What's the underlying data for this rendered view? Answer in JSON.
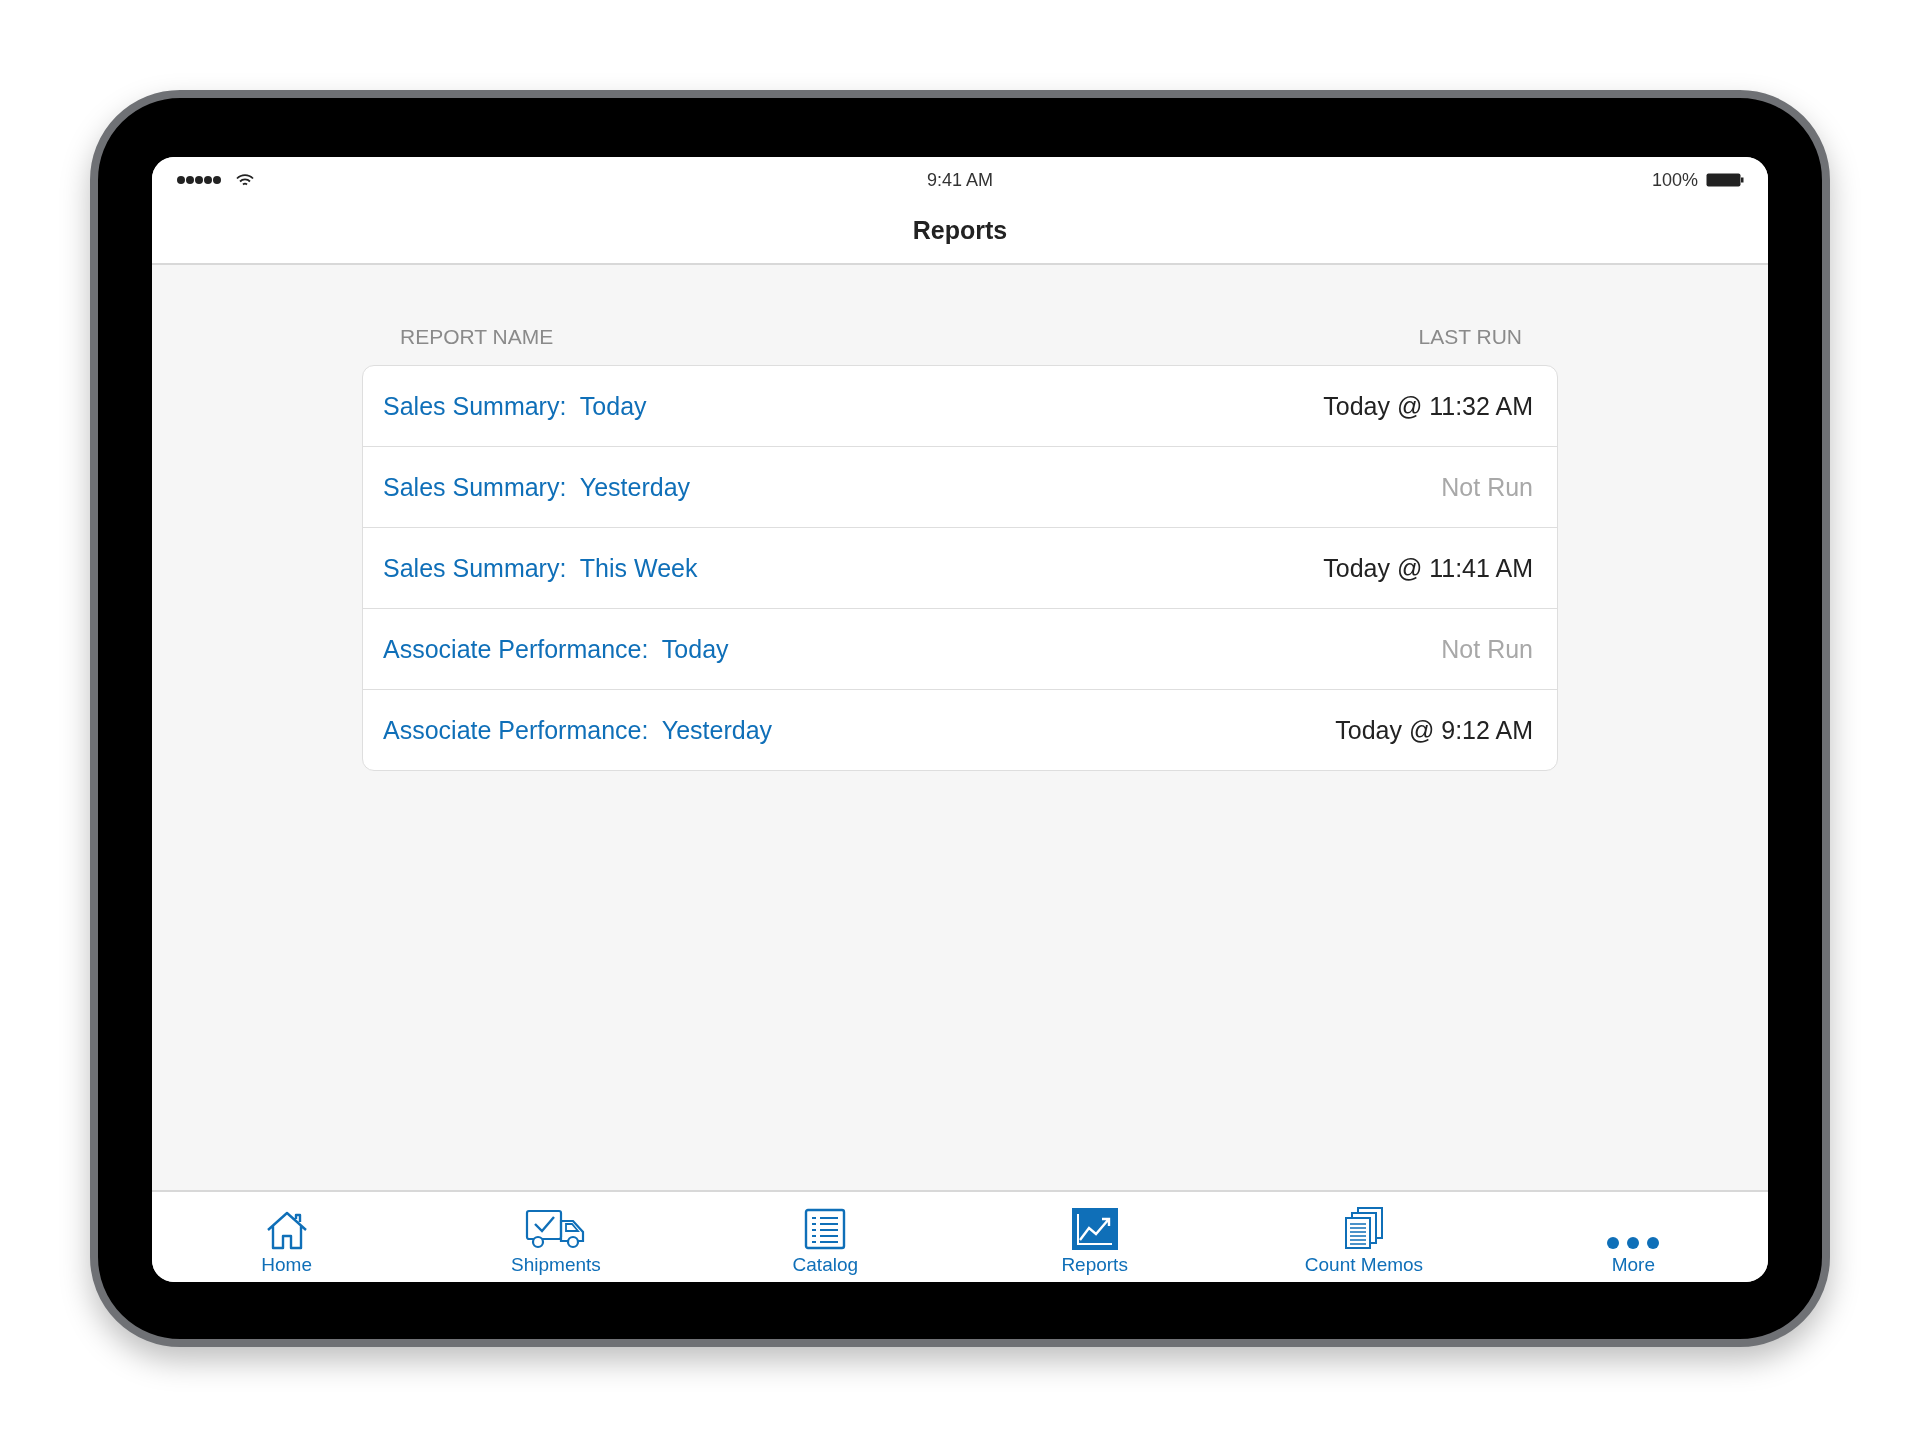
{
  "status_bar": {
    "time": "9:41 AM",
    "battery": "100%"
  },
  "nav": {
    "title": "Reports"
  },
  "table": {
    "columns": [
      "REPORT NAME",
      "LAST RUN"
    ],
    "rows": [
      {
        "name": "Sales Summary:  Today",
        "last_run": "Today @ 11:32 AM",
        "run": true
      },
      {
        "name": "Sales Summary:  Yesterday",
        "last_run": "Not Run",
        "run": false
      },
      {
        "name": "Sales Summary:  This Week",
        "last_run": "Today @ 11:41 AM",
        "run": true
      },
      {
        "name": "Associate Performance:  Today",
        "last_run": "Not Run",
        "run": false
      },
      {
        "name": "Associate Performance:  Yesterday",
        "last_run": "Today @ 9:12 AM",
        "run": true
      }
    ]
  },
  "tab_bar": [
    {
      "label": "Home",
      "kind": "home",
      "selected": false
    },
    {
      "label": "Shipments",
      "kind": "shipments",
      "selected": false
    },
    {
      "label": "Catalog",
      "kind": "catalog",
      "selected": false
    },
    {
      "label": "Reports",
      "kind": "reports",
      "selected": true
    },
    {
      "label": "Count Memos",
      "kind": "memos",
      "selected": false
    },
    {
      "label": "More",
      "kind": "more",
      "selected": false
    }
  ]
}
